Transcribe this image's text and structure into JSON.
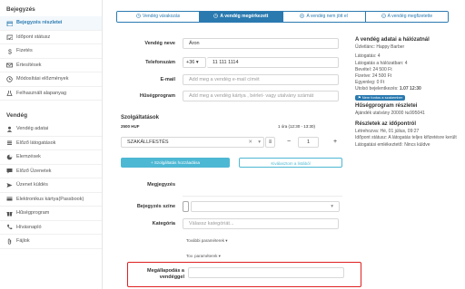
{
  "sidebar": {
    "heading1": "Bejegyzés",
    "items1": [
      {
        "label": "Bejegyzés részletei",
        "icon": "calendar-icon",
        "active": true
      },
      {
        "label": "Időpont státusz",
        "icon": "calendar-check-icon"
      },
      {
        "label": "Fizetés",
        "icon": "dollar-icon"
      },
      {
        "label": "Értesítések",
        "icon": "mail-icon"
      },
      {
        "label": "Módosítási előzmények",
        "icon": "history-icon"
      },
      {
        "label": "Felhasznált alapanyag",
        "icon": "flask-icon"
      }
    ],
    "heading2": "Vendég",
    "items2": [
      {
        "label": "Vendég adatai",
        "icon": "user-icon"
      },
      {
        "label": "Előző látogatások",
        "icon": "list-icon"
      },
      {
        "label": "Elemzések",
        "icon": "chart-icon"
      },
      {
        "label": "Előző Üzenetek",
        "icon": "message-icon"
      },
      {
        "label": "Üzenet küldés",
        "icon": "send-icon"
      },
      {
        "label": "Elektronikus kártya(Passbook)",
        "icon": "card-icon"
      },
      {
        "label": "Hűségprogram",
        "icon": "gift-icon"
      },
      {
        "label": "Hívásnapló",
        "icon": "phone-icon"
      },
      {
        "label": "Fájlok",
        "icon": "paperclip-icon"
      }
    ]
  },
  "tabs": [
    {
      "label": "Vendég várakozás",
      "icon": "clock-icon"
    },
    {
      "label": "A vendég megérkezett",
      "icon": "clock-icon",
      "active": true
    },
    {
      "label": "A vendég nem jött el",
      "icon": "x-circle-icon"
    },
    {
      "label": "A vendég megfizetette",
      "icon": "check-circle-icon"
    }
  ],
  "form": {
    "name_label": "Vendég neve",
    "name_value": "Áron",
    "phone_label": "Telefonszám",
    "phone_prefix": "+36",
    "phone_value": "11 111 1114",
    "email_label": "E-mail",
    "email_placeholder": "Add meg a vendég e-mail címét",
    "loyalty_label": "Hűségprogram",
    "loyalty_placeholder": "Add meg a vendég kártya , bérlet- vagy utalvány számát",
    "services_heading": "Szolgáltatások",
    "service_price": "2500 HUF",
    "service_time": "1 óra (12:30 - 13:30)",
    "service_name": "SZAKÁLLFESTÉS",
    "service_qty": "1",
    "service_time_right": "1 óra (12:30 - 13:30)",
    "add_service_btn": "+ Szolgáltatás hozzáadása",
    "discount_btn": "Kiválasztom a listából",
    "note_label": "Megjegyzés",
    "color_label": "Bejegyzés színe",
    "category_label": "Kategória",
    "category_placeholder": "Válassz kategóriát...",
    "more_params": "További paraméterek ▾",
    "extra_params": "Tov. paraméterek ▾",
    "agreement_label_1": "Megállapodás a",
    "agreement_label_2": "vendéggel"
  },
  "guest_panel": {
    "title": "A vendég adatai a hálózatnál",
    "salon": "Üzletlánc: Happy Barber",
    "visits": "Látogatás: 4",
    "network_visits": "Látogatás a hálózatban: 4",
    "spent": "Bevétel: 24 500 Ft",
    "paid": "Fizetve: 24 500 Ft",
    "balance": "Egyenleg: 0 Ft",
    "last_visit_label": "Utolsó bejelentkezés:",
    "last_visit_value": "1.07 12:30",
    "badge": "Nem fontos a szakember",
    "loyalty_title": "Hűségprogram részletei",
    "loyalty_line": "Ajándék utalvány 20000 №995041",
    "appointment_title": "Részletek az időpontról",
    "created": "Létrehozva: Hé, 01 július, 09:27",
    "status": "Időpont státusz: A látogatás teljes kifizetésre került",
    "reminder": "Látogatási emlékeztető: Nincs küldve"
  },
  "colors": {
    "accent": "#2a7ab0",
    "button": "#4db8d4",
    "highlight": "#e02020"
  }
}
